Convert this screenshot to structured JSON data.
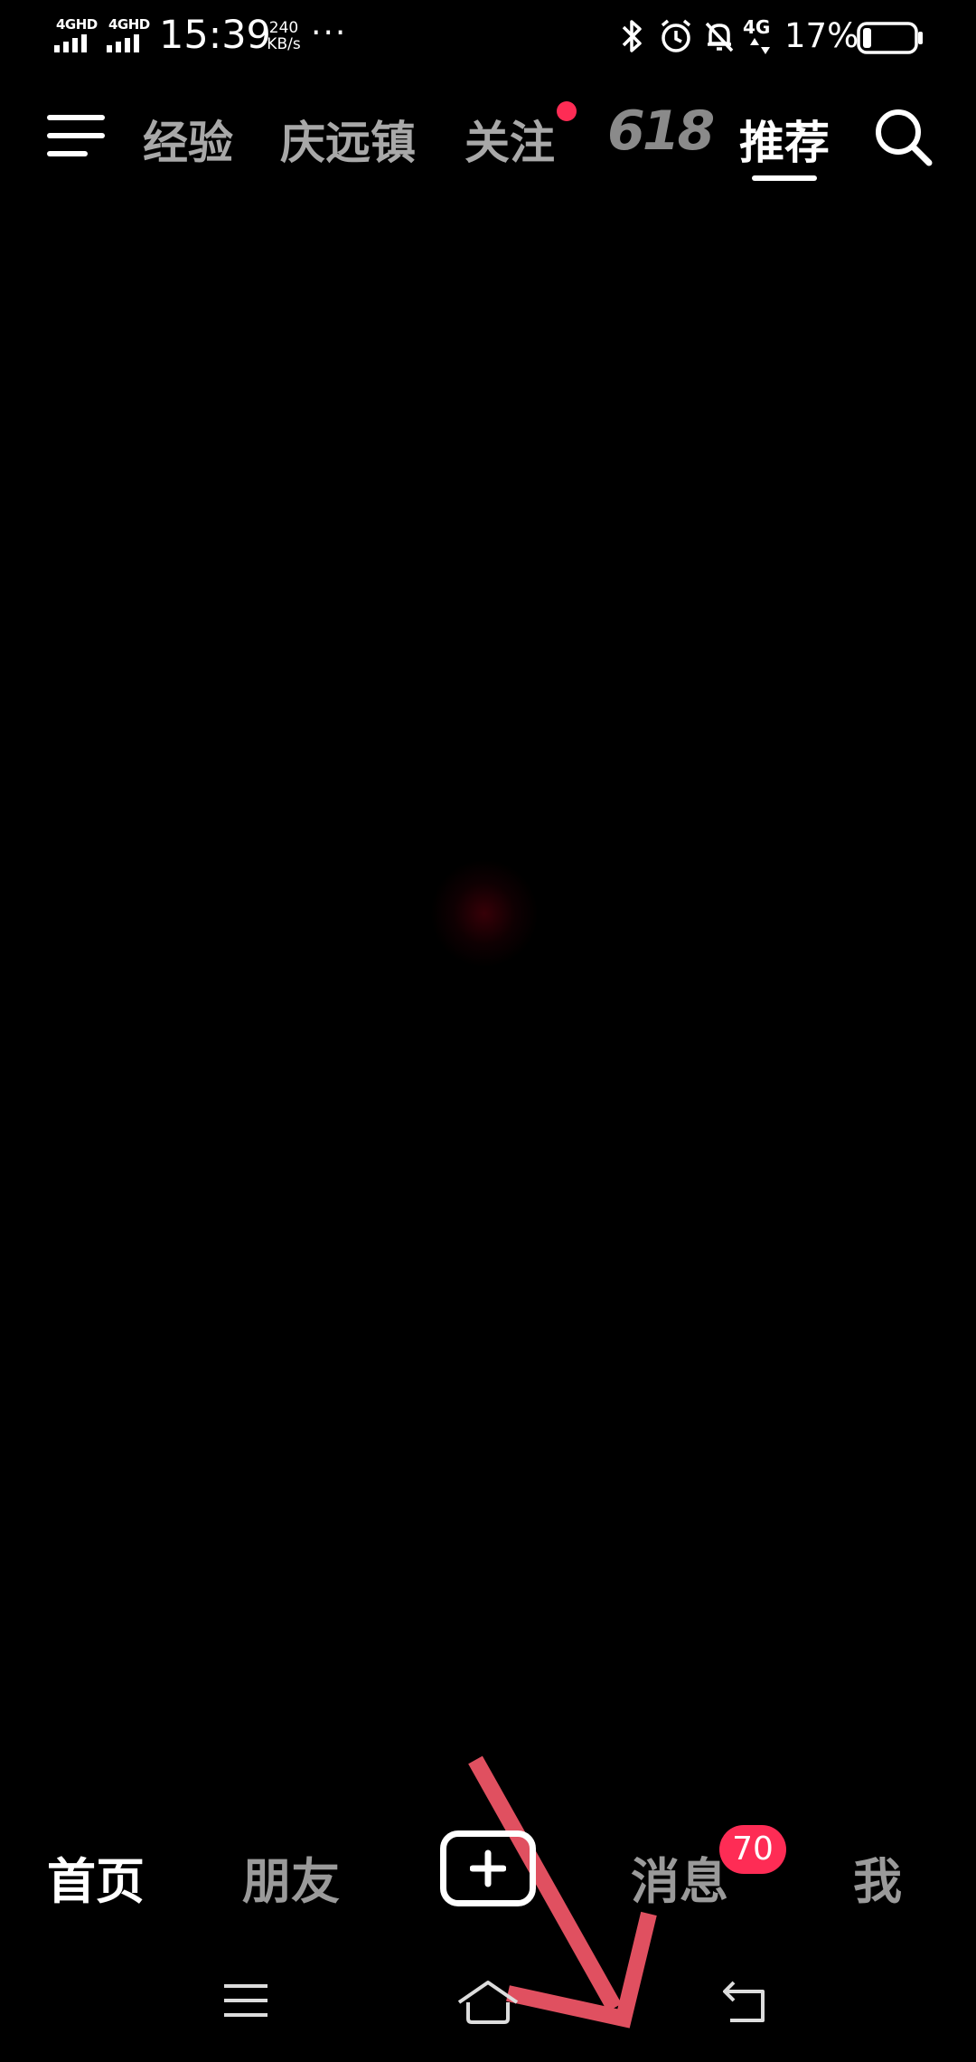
{
  "status_bar": {
    "sim1_label": "4GHD",
    "sim2_label": "4GHD",
    "time": "15:39",
    "speed_value": "240",
    "speed_unit": "KB/s",
    "more_dots": "···",
    "network_label": "4G",
    "battery_percent": "17%",
    "icons": [
      "bluetooth-icon",
      "alarm-icon",
      "mute-bell-icon",
      "network-4g-icon",
      "battery-icon"
    ]
  },
  "top_nav": {
    "tabs": [
      {
        "label": "经验"
      },
      {
        "label": "庆远镇"
      },
      {
        "label": "关注",
        "has_dot": true
      },
      {
        "label": "618"
      },
      {
        "label": "推荐",
        "active": true
      }
    ]
  },
  "bottom_nav": {
    "home": "首页",
    "friends": "朋友",
    "messages": "消息",
    "messages_badge": "70",
    "me": "我"
  },
  "colors": {
    "background": "#000000",
    "accent_red": "#fe2c55",
    "annotation_arrow": "#e05060",
    "inactive_text": "#a8a8a8"
  }
}
